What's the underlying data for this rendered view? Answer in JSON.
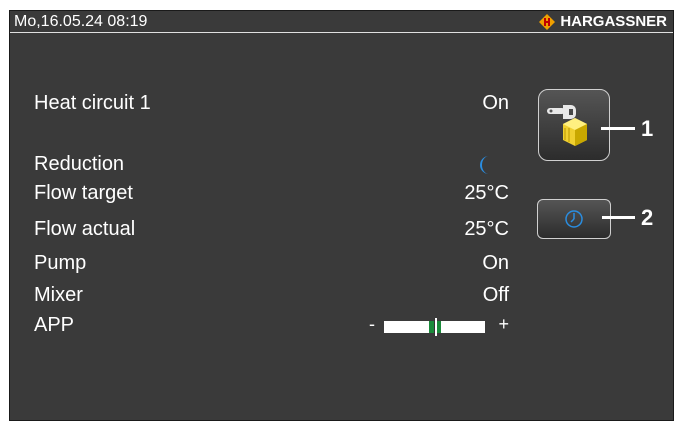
{
  "statusbar": {
    "datetime": "Mo,16.05.24 08:19",
    "brand": "HARGASSNER",
    "brand_logo": "hargassner-flame-logo",
    "brand_color": "#f0a000"
  },
  "rows": [
    {
      "label": "Heat circuit 1",
      "value": "On"
    },
    {
      "label": "Reduction",
      "value_icon": "moon-icon",
      "icon_color": "#2a8de0"
    },
    {
      "label": "Flow target",
      "value": "25°C"
    },
    {
      "label": "Flow actual",
      "value": "25°C"
    },
    {
      "label": "Pump",
      "value": "On"
    },
    {
      "label": "Mixer",
      "value": "Off"
    },
    {
      "label": "APP",
      "slider": {
        "minus": "-",
        "plus": "+",
        "level": 0.5
      }
    }
  ],
  "buttons": [
    {
      "name": "settings-heat-circuit-button",
      "icon": "wrench-and-cube-icon",
      "callout": "1"
    },
    {
      "name": "time-program-button",
      "icon": "clock-icon",
      "callout": "2"
    }
  ]
}
